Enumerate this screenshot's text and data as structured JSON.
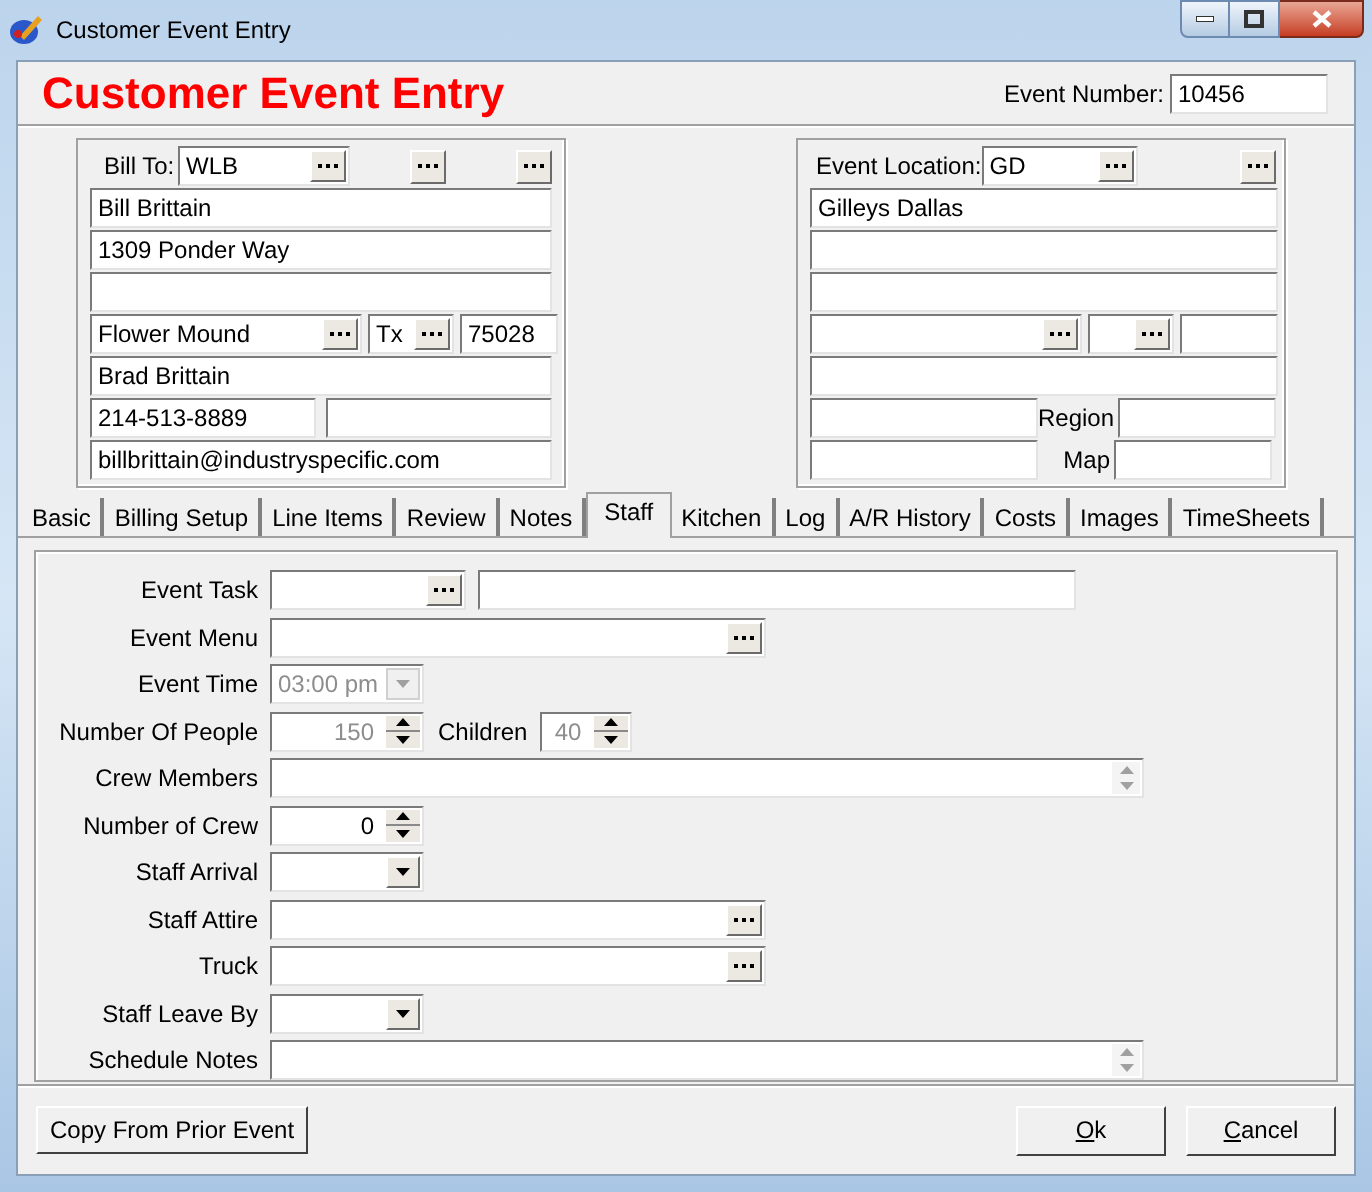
{
  "window": {
    "title": "Customer Event Entry"
  },
  "header": {
    "title": "Customer Event Entry",
    "event_number": {
      "label": "Event Number:",
      "value": "10456"
    }
  },
  "bill_to": {
    "label": "Bill To:",
    "code": "WLB",
    "name": "Bill Brittain",
    "address": "1309 Ponder Way",
    "city": "Flower Mound",
    "state": "Tx",
    "zip": "75028",
    "contact": "Brad Brittain",
    "phone": "214-513-8889",
    "email": "billbrittain@industryspecific.com"
  },
  "event_location": {
    "label": "Event Location:",
    "code": "GD",
    "name": "Gilleys Dallas",
    "region_label": "Region",
    "map_label": "Map"
  },
  "tabs": [
    {
      "label": "Basic",
      "selected": false
    },
    {
      "label": "Billing Setup",
      "selected": false
    },
    {
      "label": "Line Items",
      "selected": false
    },
    {
      "label": "Review",
      "selected": false
    },
    {
      "label": "Notes",
      "selected": false
    },
    {
      "label": "Staff",
      "selected": true
    },
    {
      "label": "Kitchen",
      "selected": false
    },
    {
      "label": "Log",
      "selected": false
    },
    {
      "label": "A/R History",
      "selected": false
    },
    {
      "label": "Costs",
      "selected": false
    },
    {
      "label": "Images",
      "selected": false
    },
    {
      "label": "TimeSheets",
      "selected": false
    }
  ],
  "staff_form": [
    {
      "kind": "lookup-pair",
      "label": "Event Task"
    },
    {
      "kind": "lookup",
      "label": "Event Menu"
    },
    {
      "kind": "time",
      "label": "Event Time",
      "value": "03:00 pm",
      "disabled": true
    },
    {
      "kind": "people",
      "label": "Number Of People",
      "value": "150",
      "disabled": true,
      "children_label": "Children",
      "children_value": "40"
    },
    {
      "kind": "memo",
      "label": "Crew Members"
    },
    {
      "kind": "spin",
      "label": "Number of Crew",
      "value": "0",
      "disabled": false
    },
    {
      "kind": "dropdown",
      "label": "Staff Arrival"
    },
    {
      "kind": "lookup",
      "label": "Staff Attire"
    },
    {
      "kind": "lookup",
      "label": "Truck"
    },
    {
      "kind": "dropdown",
      "label": "Staff Leave By"
    },
    {
      "kind": "memo",
      "label": "Schedule Notes"
    }
  ],
  "buttons": {
    "copy": "Copy From Prior Event",
    "ok": "Ok",
    "cancel": "Cancel"
  }
}
